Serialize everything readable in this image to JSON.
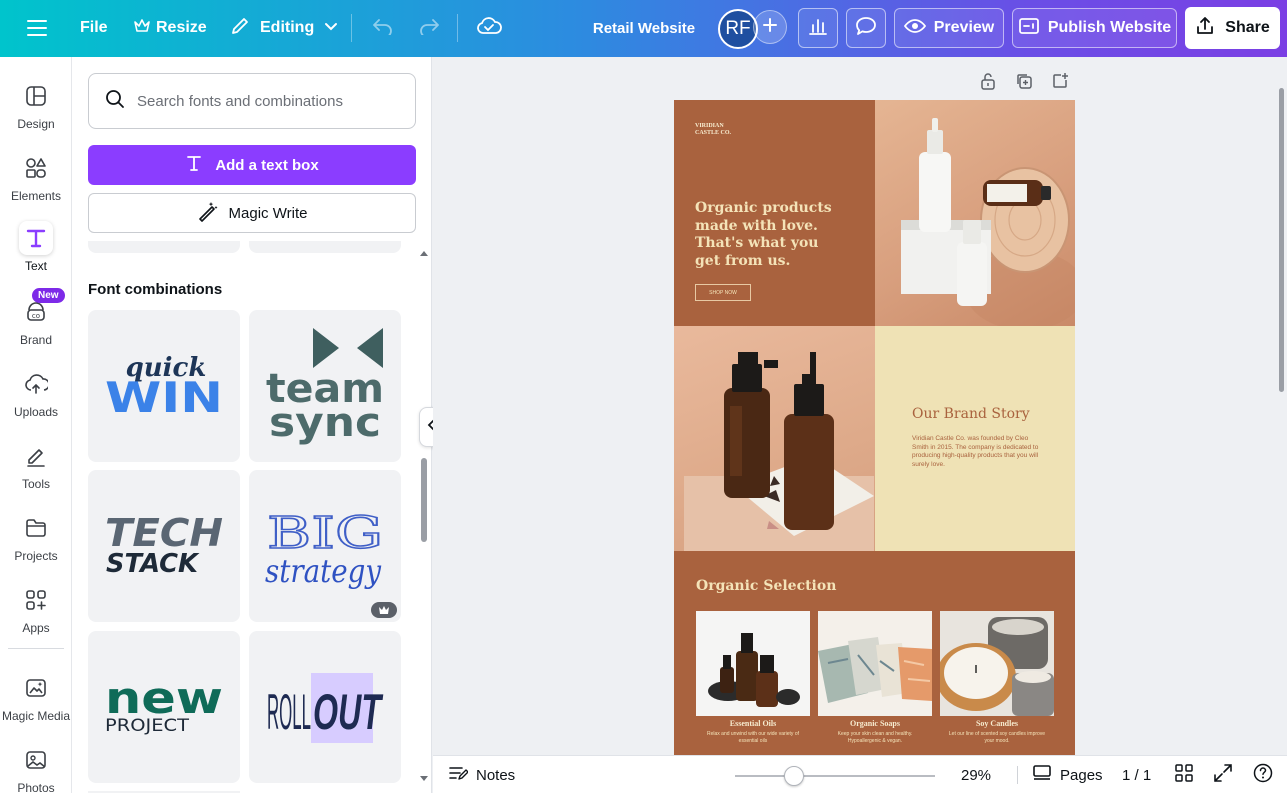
{
  "topbar": {
    "file_label": "File",
    "resize_label": "Resize",
    "editing_label": "Editing",
    "design_title": "Retail Website",
    "avatar_initials": "RF",
    "preview_label": "Preview",
    "publish_label": "Publish Website",
    "share_label": "Share"
  },
  "rail": {
    "items": [
      {
        "label": "Design",
        "icon": "design-icon"
      },
      {
        "label": "Elements",
        "icon": "elements-icon"
      },
      {
        "label": "Text",
        "icon": "text-icon"
      },
      {
        "label": "Brand",
        "icon": "brand-icon",
        "badge": "New"
      },
      {
        "label": "Uploads",
        "icon": "uploads-icon"
      },
      {
        "label": "Tools",
        "icon": "tools-icon"
      },
      {
        "label": "Projects",
        "icon": "projects-icon"
      },
      {
        "label": "Apps",
        "icon": "apps-icon"
      },
      {
        "label": "Magic Media",
        "icon": "magic-media-icon"
      },
      {
        "label": "Photos",
        "icon": "photos-icon"
      }
    ]
  },
  "panel": {
    "search_placeholder": "Search fonts and combinations",
    "add_text_label": "Add a text box",
    "magic_write_label": "Magic Write",
    "section_title": "Font combinations"
  },
  "document": {
    "logo_line1": "VIRIDIAN",
    "logo_line2": "CASTLE CO.",
    "hero_heading": "Organic products made with love. That's what you get from us.",
    "shop_button": "SHOP NOW",
    "story_title": "Our Brand Story",
    "story_body": "Viridian Castle Co. was founded by Cleo Smith in 2015. The company is dedicated to producing high-quality products that you will surely love.",
    "selection_title": "Organic Selection",
    "products": [
      {
        "name": "Essential Oils",
        "desc": "Relax and unwind with our wide variety of essential oils"
      },
      {
        "name": "Organic Soaps",
        "desc": "Keep your skin clean and healthy. Hypoallergenic & vegan."
      },
      {
        "name": "Soy Candles",
        "desc": "Let our line of scented soy candles improve your mood."
      }
    ]
  },
  "bottombar": {
    "notes_label": "Notes",
    "zoom_value": "29%",
    "pages_label": "Pages",
    "page_count": "1 / 1"
  },
  "colors": {
    "accent": "#8b3dff",
    "doc_terracotta": "#a9623e",
    "doc_cream": "#efe2b5"
  }
}
